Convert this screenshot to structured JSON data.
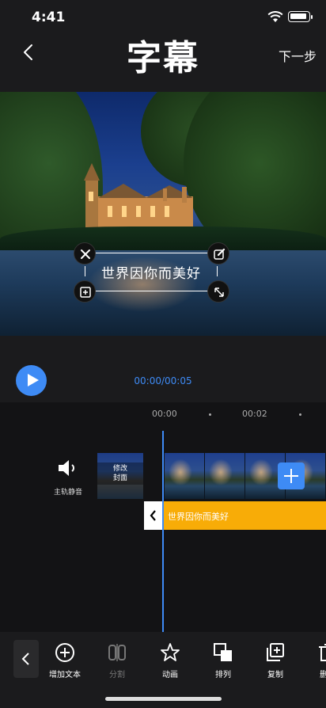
{
  "status_bar": {
    "time": "4:41"
  },
  "header": {
    "title": "字幕",
    "next_label": "下一步"
  },
  "preview": {
    "subtitle_text": "世界因你而美好"
  },
  "player": {
    "timecode": "00:00/00:05"
  },
  "timeline": {
    "ruler": [
      "00:00",
      "00:02"
    ],
    "mute_label": "主轨静音",
    "cover_label": "修改\n封面",
    "caption_clip_text": "世界因你而美好"
  },
  "toolbar": {
    "items": [
      {
        "label": "增加文本",
        "icon": "plus-circle-icon"
      },
      {
        "label": "分割",
        "icon": "split-icon",
        "disabled": true
      },
      {
        "label": "动画",
        "icon": "star-icon"
      },
      {
        "label": "排列",
        "icon": "layers-icon"
      },
      {
        "label": "复制",
        "icon": "copy-icon"
      },
      {
        "label": "删",
        "icon": "trash-icon"
      }
    ]
  },
  "colors": {
    "accent": "#3e8bf5",
    "caption_clip": "#f8ac07",
    "background": "#1b1b1d"
  }
}
